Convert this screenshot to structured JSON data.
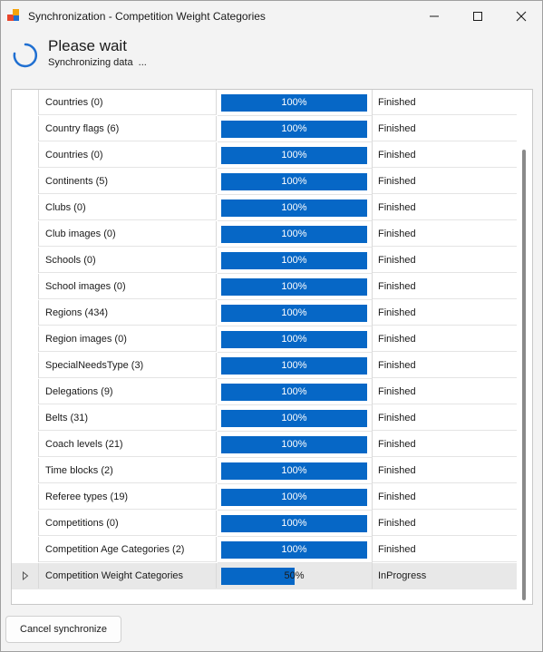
{
  "window": {
    "title": "Synchronization - Competition Weight Categories",
    "icon": "app-logo-icon",
    "controls": [
      "minimize-icon",
      "maximize-icon",
      "close-icon"
    ]
  },
  "header": {
    "title": "Please wait",
    "subtitle": "Synchronizing data  ...",
    "spinner_icon": "loading-spinner-icon"
  },
  "colors": {
    "progress_fill": "#0667c6",
    "active_row": "#e8e8e8"
  },
  "rows": [
    {
      "name": "Countries (0)",
      "progress": 100,
      "progress_label": "100%",
      "status": "Finished"
    },
    {
      "name": "Country flags (6)",
      "progress": 100,
      "progress_label": "100%",
      "status": "Finished"
    },
    {
      "name": "Countries (0)",
      "progress": 100,
      "progress_label": "100%",
      "status": "Finished"
    },
    {
      "name": "Continents (5)",
      "progress": 100,
      "progress_label": "100%",
      "status": "Finished"
    },
    {
      "name": "Clubs (0)",
      "progress": 100,
      "progress_label": "100%",
      "status": "Finished"
    },
    {
      "name": "Club images (0)",
      "progress": 100,
      "progress_label": "100%",
      "status": "Finished"
    },
    {
      "name": "Schools (0)",
      "progress": 100,
      "progress_label": "100%",
      "status": "Finished"
    },
    {
      "name": "School images (0)",
      "progress": 100,
      "progress_label": "100%",
      "status": "Finished"
    },
    {
      "name": "Regions (434)",
      "progress": 100,
      "progress_label": "100%",
      "status": "Finished"
    },
    {
      "name": "Region images (0)",
      "progress": 100,
      "progress_label": "100%",
      "status": "Finished"
    },
    {
      "name": "SpecialNeedsType (3)",
      "progress": 100,
      "progress_label": "100%",
      "status": "Finished"
    },
    {
      "name": "Delegations (9)",
      "progress": 100,
      "progress_label": "100%",
      "status": "Finished"
    },
    {
      "name": "Belts (31)",
      "progress": 100,
      "progress_label": "100%",
      "status": "Finished"
    },
    {
      "name": "Coach levels (21)",
      "progress": 100,
      "progress_label": "100%",
      "status": "Finished"
    },
    {
      "name": "Time blocks (2)",
      "progress": 100,
      "progress_label": "100%",
      "status": "Finished"
    },
    {
      "name": "Referee types (19)",
      "progress": 100,
      "progress_label": "100%",
      "status": "Finished"
    },
    {
      "name": "Competitions (0)",
      "progress": 100,
      "progress_label": "100%",
      "status": "Finished"
    },
    {
      "name": "Competition Age Categories (2)",
      "progress": 100,
      "progress_label": "100%",
      "status": "Finished"
    },
    {
      "name": "Competition Weight Categories",
      "progress": 50,
      "progress_label": "50%",
      "status": "InProgress",
      "active": true
    }
  ],
  "footer": {
    "cancel_label": "Cancel synchronize"
  }
}
